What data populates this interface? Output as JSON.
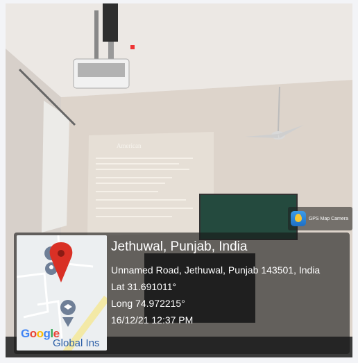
{
  "badge": {
    "app_name": "GPS Map Camera",
    "icon": "gps-map-camera-app-icon"
  },
  "location": {
    "title": "Jethuwal, Punjab, India",
    "address": "Unnamed Road, Jethuwal, Punjab 143501, India",
    "lat": "Lat 31.691011°",
    "long": "Long 74.972215°",
    "datetime": "16/12/21 12:37 PM"
  },
  "map": {
    "google_letters": [
      {
        "ch": "G",
        "color": "#4285F4"
      },
      {
        "ch": "o",
        "color": "#EA4335"
      },
      {
        "ch": "o",
        "color": "#FBBC05"
      },
      {
        "ch": "g",
        "color": "#4285F4"
      },
      {
        "ch": "l",
        "color": "#34A853"
      },
      {
        "ch": "e",
        "color": "#EA4335"
      }
    ],
    "place_label": "Global Ins",
    "pin_color": "#d93025",
    "icons": [
      "map-pin-icon",
      "person-place-icon",
      "school-place-icon"
    ]
  },
  "projection": {
    "logo_text": "American Megatrends"
  }
}
